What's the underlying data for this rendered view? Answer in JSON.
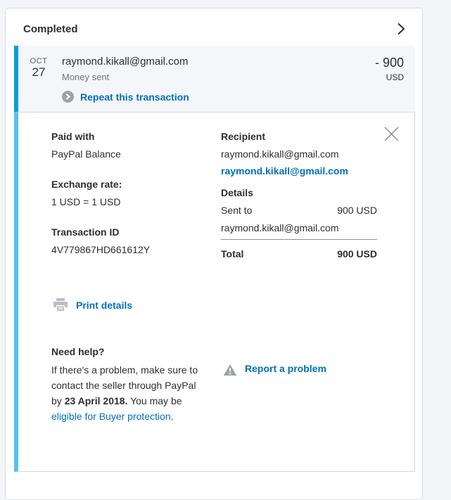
{
  "header": {
    "title": "Completed"
  },
  "transaction": {
    "date_month": "OCT",
    "date_day": "27",
    "payee": "raymond.kikall@gmail.com",
    "type": "Money sent",
    "amount": "- 900",
    "currency": "USD",
    "repeat_label": "Repeat this transaction"
  },
  "details_panel": {
    "paid_with_label": "Paid with",
    "paid_with_value": "PayPal Balance",
    "exchange_rate_label": "Exchange rate:",
    "exchange_rate_value": "1 USD = 1 USD",
    "transaction_id_label": "Transaction ID",
    "transaction_id_value": "4V779867HD661612Y",
    "recipient_label": "Recipient",
    "recipient_name": "raymond.kikall@gmail.com",
    "recipient_email_link": "raymond.kikall@gmail.com",
    "details_label": "Details",
    "sent_to_label": "Sent to",
    "sent_to_amount": "900 USD",
    "sent_to_email": "raymond.kikall@gmail.com",
    "total_label": "Total",
    "total_amount": "900 USD",
    "print_label": "Print details"
  },
  "help": {
    "title": "Need help?",
    "body_1": "If there's a problem, make sure to contact the seller through PayPal by ",
    "deadline": "23 April 2018.",
    "body_2": " You may be ",
    "link": "eligible for Buyer protection",
    "body_3": ".",
    "report_label": "Report a problem"
  },
  "icons": {
    "chevron_right": "chevron-right-icon",
    "repeat": "repeat-circle-arrow-icon",
    "close": "close-x-icon",
    "printer": "printer-icon",
    "warning": "warning-triangle-icon"
  },
  "colors": {
    "accent_dark_blue": "#009cde",
    "accent_light_blue": "#55c1f1",
    "link_blue": "#0070ba",
    "page_background": "#f3f5f8",
    "row_background": "#f5f6f9",
    "text_dark": "#2c2e2f",
    "text_gray": "#6c7378"
  }
}
